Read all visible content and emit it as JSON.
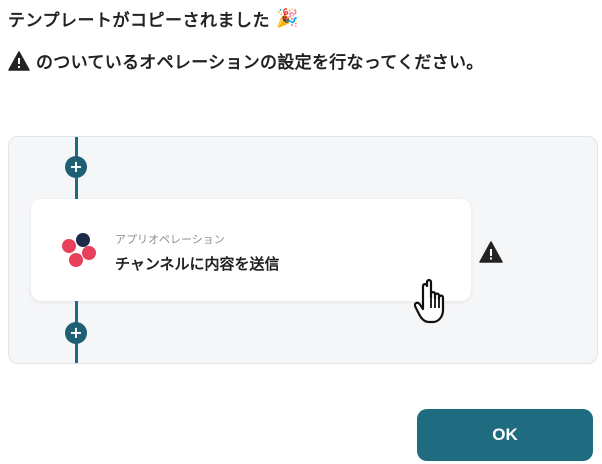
{
  "header": {
    "title": "テンプレートがコピーされました",
    "instruction": "のついているオペレーションの設定を行なってください。"
  },
  "flow": {
    "card": {
      "subtitle": "アプリオペレーション",
      "title": "チャンネルに内容を送信"
    },
    "add_symbol": "+"
  },
  "footer": {
    "ok_label": "OK"
  },
  "icons": {
    "title_emoji": "party-popper-icon",
    "warning": "warning-icon",
    "app_logo": "asana-logo-icon",
    "cursor": "hand-pointer-icon"
  },
  "colors": {
    "accent": "#1f6b80",
    "logo_dark": "#1e2a4a",
    "logo_red": "#e8405a"
  }
}
